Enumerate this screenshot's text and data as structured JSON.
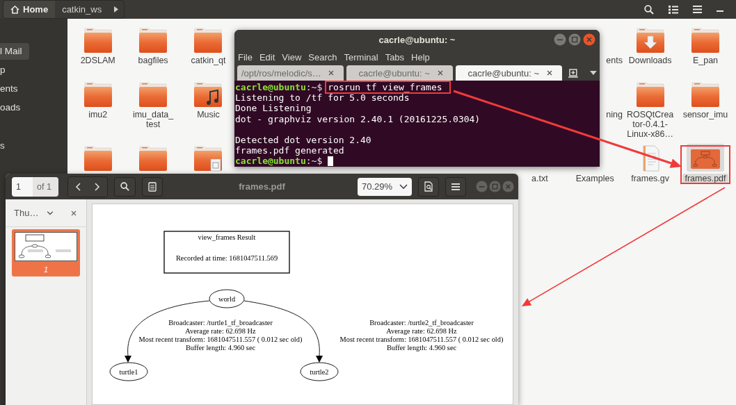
{
  "file_manager": {
    "path": [
      {
        "label": "Home",
        "kind": "home",
        "selected": true
      },
      {
        "label": "catkin_ws",
        "kind": "folder",
        "selected": false
      }
    ],
    "sidebar": [
      {
        "label": "l Mail",
        "selected": true
      },
      {
        "label": "p",
        "selected": false
      },
      {
        "label": "ents",
        "selected": false
      },
      {
        "label": "oads",
        "selected": false
      },
      {
        "label": "s",
        "selected": false
      }
    ],
    "files_left": [
      [
        {
          "kind": "folder",
          "lines": [
            "2DSLAM"
          ]
        },
        {
          "kind": "folder",
          "lines": [
            "bagfiles"
          ]
        },
        {
          "kind": "folder",
          "lines": [
            "catkin_qt"
          ]
        }
      ],
      [
        {
          "kind": "folder",
          "lines": [
            "imu2"
          ]
        },
        {
          "kind": "folder",
          "lines": [
            "imu_data_",
            "test"
          ]
        },
        {
          "kind": "music",
          "lines": [
            "Music"
          ]
        }
      ],
      [
        {
          "kind": "folder"
        },
        {
          "kind": "folder"
        },
        {
          "kind": "templates"
        }
      ]
    ],
    "partly_hidden_file": {
      "lines": [
        "a.txt"
      ]
    },
    "files_right": [
      [
        {
          "lines": [
            "ents"
          ]
        },
        {
          "kind": "downloads",
          "lines": [
            "Downloads"
          ]
        },
        {
          "kind": "folder",
          "lines": [
            "E_pan"
          ]
        }
      ],
      [
        {
          "lines": [
            "ning"
          ]
        },
        {
          "kind": "folder",
          "lines": [
            "ROSQtCrea",
            "tor-0.4.1-",
            "Linux-x86…"
          ]
        },
        {
          "kind": "folder",
          "lines": [
            "sensor_imu"
          ]
        }
      ],
      [
        {
          "lines": [
            "Examples"
          ]
        },
        {
          "kind": "text",
          "lines": [
            "frames.gv"
          ]
        },
        {
          "kind": "pdf",
          "lines": [
            "frames.pdf"
          ],
          "selected": true,
          "highlighted": true
        }
      ]
    ]
  },
  "terminal": {
    "title": "cacrle@ubuntu: ~",
    "menu": [
      "File",
      "Edit",
      "View",
      "Search",
      "Terminal",
      "Tabs",
      "Help"
    ],
    "tabs": [
      {
        "label": "/opt/ros/melodic/s…",
        "selected": false
      },
      {
        "label": "cacrle@ubuntu: ~",
        "selected": false
      },
      {
        "label": "cacrle@ubuntu: ~",
        "selected": true
      }
    ],
    "lines": [
      {
        "kind": "prompt",
        "user": "cacrle@ubuntu",
        "path": ":~$",
        "command": "rosrun tf view_frames",
        "highlighted": true
      },
      {
        "kind": "output",
        "text": "Listening to /tf for 5.0 seconds"
      },
      {
        "kind": "output",
        "text": "Done Listening"
      },
      {
        "kind": "output",
        "text": "dot - graphviz version 2.40.1 (20161225.0304)"
      },
      {
        "kind": "blank"
      },
      {
        "kind": "output",
        "text": "Detected dot version 2.40"
      },
      {
        "kind": "output",
        "text": "frames.pdf generated"
      },
      {
        "kind": "prompt",
        "user": "cacrle@ubuntu",
        "path": ":~$",
        "cursor": true
      }
    ]
  },
  "pdf_viewer": {
    "page": "1",
    "page_count": "of 1",
    "title": "frames.pdf",
    "zoom": "70.29%",
    "sidebar": {
      "mode": "Thu…",
      "thumbnails": [
        {
          "label": "1",
          "selected": true
        }
      ]
    },
    "document": {
      "title": "view_frames Result",
      "recorded": "Recorded at time: 1681047511.569",
      "nodes": [
        {
          "label": "world"
        },
        {
          "label": "turtle1"
        },
        {
          "label": "turtle2"
        }
      ],
      "edges": [
        {
          "lines": [
            "Broadcaster: /turtle1_tf_broadcaster",
            "Average rate: 62.698 Hz",
            "Most recent transform: 1681047511.557 ( 0.012 sec old)",
            "Buffer length: 4.960 sec"
          ]
        },
        {
          "lines": [
            "Broadcaster: /turtle2_tf_broadcaster",
            "Average rate: 62.698 Hz",
            "Most recent transform: 1681047511.557 ( 0.012 sec old)",
            "Buffer length: 4.960 sec"
          ]
        }
      ]
    }
  }
}
